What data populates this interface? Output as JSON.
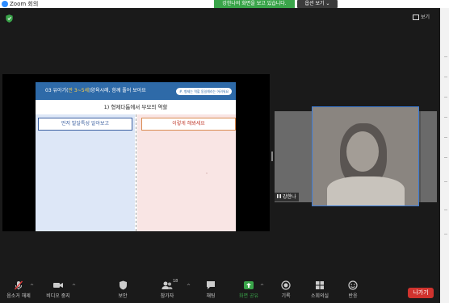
{
  "window": {
    "title": "Zoom 회의"
  },
  "banner": {
    "text": "강한나의 화면을 보고 있습니다.",
    "options_label": "옵션 보기 ⌄"
  },
  "meeting": {
    "view_label": "보기"
  },
  "slide": {
    "title_prefix": "03 유아기(",
    "title_highlight": "만 3~5세",
    "title_suffix": ")양육시례, 함께 풀어 보아요",
    "subtitle": "#. 형제는 역할 동일해라는 어려워요",
    "section": "1) 형제다툼에서 부모의 역할",
    "left_box": "먼저 발달특성 알아보고",
    "right_box": "이렇게 해봐세요"
  },
  "participant": {
    "name": "강한나"
  },
  "toolbar": {
    "mute": "음소거 해제",
    "video": "비디오 중지",
    "security": "보안",
    "participants": "참가자",
    "participants_count": "18",
    "chat": "채팅",
    "share": "화면 공유",
    "record": "기록",
    "breakout": "소회의실",
    "reactions": "반응",
    "leave": "나가기"
  },
  "colors": {
    "accent": "#2d8cff",
    "share_green": "#3aa54a",
    "leave_red": "#d0332e",
    "slide_header": "#2e6aa8"
  }
}
